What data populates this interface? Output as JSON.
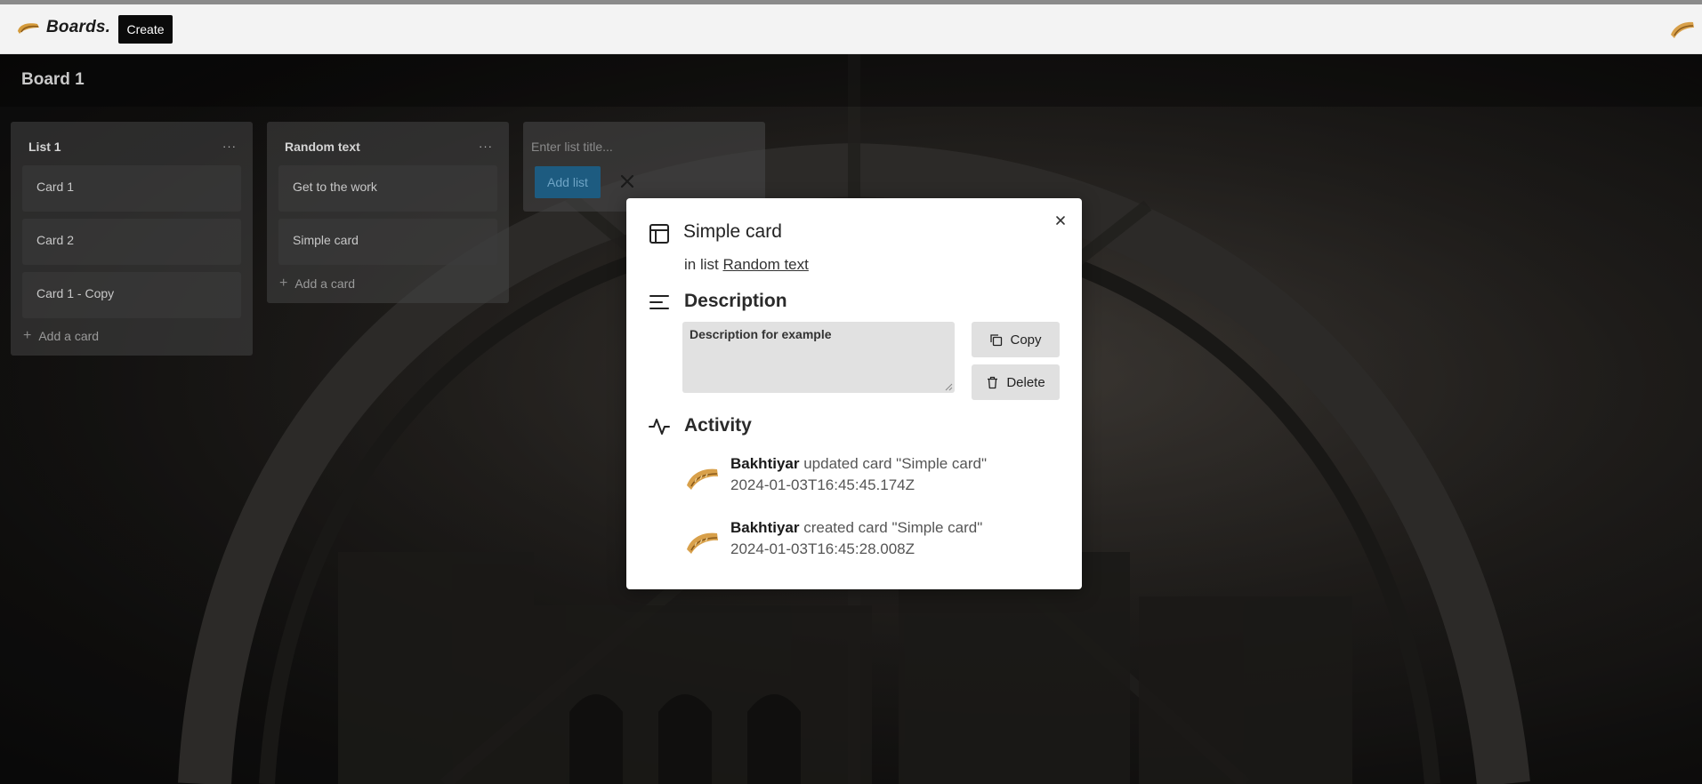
{
  "navbar": {
    "logo_text": "Boards.",
    "create_label": "Create"
  },
  "board": {
    "title": "Board 1"
  },
  "lists": [
    {
      "title": "List 1",
      "menu": "···",
      "cards": [
        "Card 1",
        "Card 2",
        "Card 1 - Copy"
      ],
      "add_card_label": "Add a card"
    },
    {
      "title": "Random text",
      "menu": "···",
      "cards": [
        "Get to the work",
        "Simple card"
      ],
      "add_card_label": "Add a card"
    }
  ],
  "new_list": {
    "placeholder": "Enter list title...",
    "add_label": "Add list"
  },
  "modal": {
    "title": "Simple card",
    "in_list_prefix": "in list",
    "list_name": "Random text",
    "description_heading": "Description",
    "description_value": "Description for example",
    "copy_label": "Copy",
    "delete_label": "Delete",
    "activity_heading": "Activity",
    "activity": [
      {
        "user": "Bakhtiyar",
        "action": "updated card \"Simple card\"",
        "timestamp": "2024-01-03T16:45:45.174Z"
      },
      {
        "user": "Bakhtiyar",
        "action": "created card \"Simple card\"",
        "timestamp": "2024-01-03T16:45:28.008Z"
      }
    ]
  }
}
